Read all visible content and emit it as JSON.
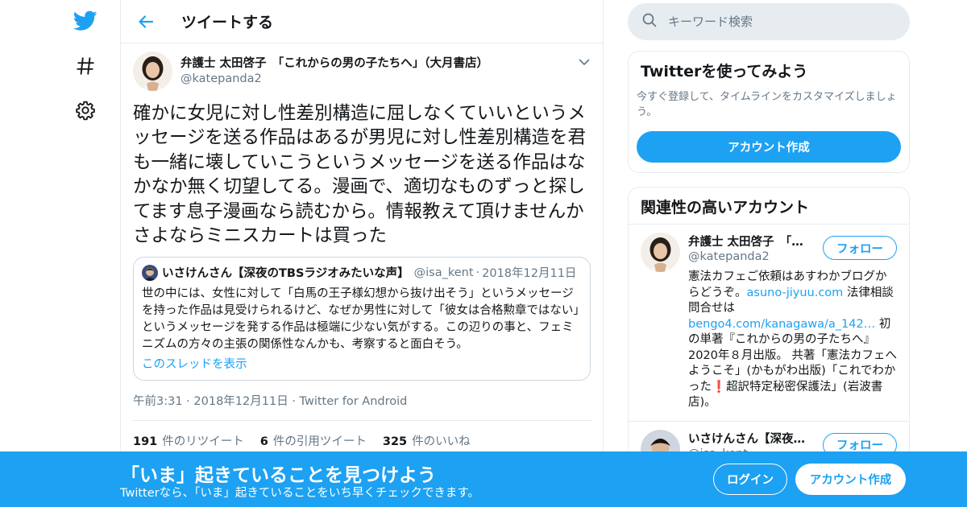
{
  "header": {
    "title": "ツイートする"
  },
  "tweet": {
    "author_name": "弁護士 太田啓子　「これからの男の子たちへ」（大月書店）",
    "author_handle": "@katepanda2",
    "body": "確かに女児に対し性差別構造に屈しなくていいというメッセージを送る作品はあるが男児に対し性差別構造を君も一緒に壊していこうというメッセージを送る作品はなかなか無く切望してる。漫画で、適切なものずっと探してます息子漫画なら読むから。情報教えて頂けませんかさよならミニスカートは買った",
    "quote": {
      "name": "いさけんさん【深夜のTBSラジオみたいな声】",
      "handle": "@isa_kent",
      "date": "2018年12月11日",
      "text": "世の中には、女性に対して「白馬の王子様幻想から抜け出そう」というメッセージを持った作品は見受けられるけど、なぜか男性に対して「彼女は合格勲章ではない」というメッセージを発する作品は極端に少ない気がする。この辺りの事と、フェミニズムの方々の主張の関係性なんかも、考察すると面白そう。",
      "thread_link": "このスレッドを表示"
    },
    "time": "午前3:31",
    "date": "2018年12月11日",
    "source": "Twitter for Android",
    "retweets": "191",
    "retweets_label": "件のリツイート",
    "quotes": "6",
    "quotes_label": "件の引用ツイート",
    "likes": "325",
    "likes_label": "件のいいね"
  },
  "search": {
    "placeholder": "キーワード検索"
  },
  "signup_card": {
    "title": "Twitterを使ってみよう",
    "subtitle": "今すぐ登録して、タイムラインをカスタマイズしましょう。",
    "button": "アカウント作成"
  },
  "related": {
    "title": "関連性の高いアカウント",
    "follow_label": "フォロー",
    "accounts": [
      {
        "name": "弁護士 太田啓子　「…",
        "handle": "@katepanda2",
        "bio_1": "憲法カフェご依頼はあすわかブログからどうぞ。",
        "bio_link_1": "asuno-jiyuu.com",
        "bio_2": " 法律相談問合せは",
        "bio_link_2": "bengo4.com/kanagawa/a_142…",
        "bio_3": " 初の単著『これからの男の子たちへ』2020年８月出版。 共著「憲法カフェへようこそ」(かもがわ出版)「これでわかった",
        "bio_emoji": "❗",
        "bio_4": "超訳特定秘密保護法」(岩波書店)。"
      },
      {
        "name": "いさけんさん【深夜…",
        "handle": "@isa_kent"
      }
    ]
  },
  "banner": {
    "title": "「いま」起きていることを見つけよう",
    "subtitle": "Twitterなら、「いま」起きていることをいち早くチェックできます。",
    "login": "ログイン",
    "signup": "アカウント作成"
  },
  "colors": {
    "accent": "#1da1f2",
    "text": "#14171a",
    "muted": "#657786",
    "border": "#e6ecf0"
  }
}
